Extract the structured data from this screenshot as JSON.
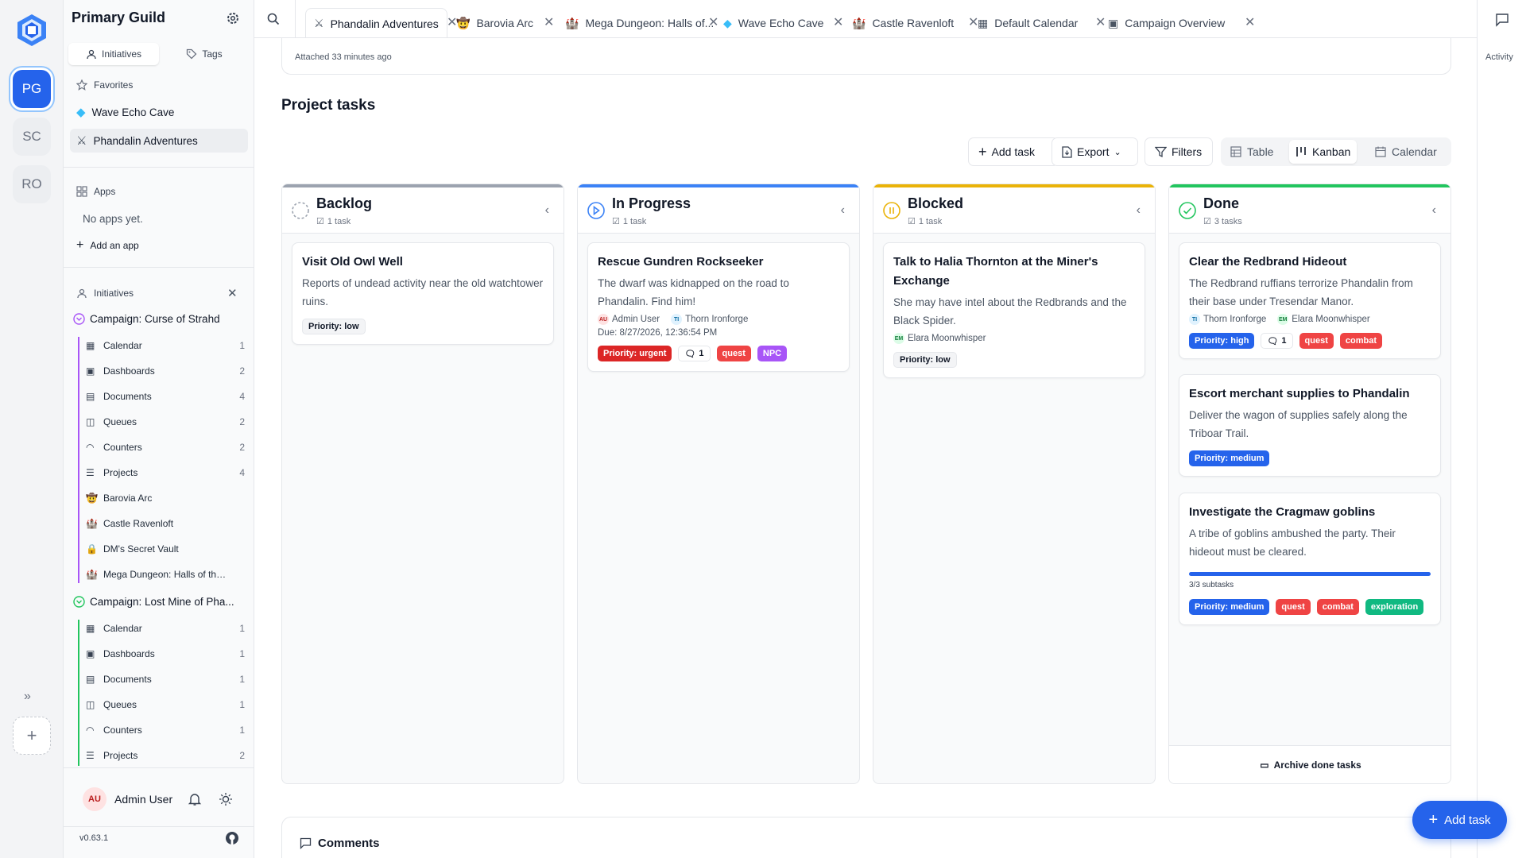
{
  "rail": {
    "workspaces": [
      "PG",
      "SC",
      "RO"
    ],
    "expand_glyph": "»",
    "add_glyph": "+"
  },
  "sidebar": {
    "guild_title": "Primary Guild",
    "tabs": [
      {
        "label": "Initiatives",
        "icon": "users-icon"
      },
      {
        "label": "Tags",
        "icon": "tag-icon"
      }
    ],
    "favorites_label": "Favorites",
    "favorites": [
      {
        "label": "Wave Echo Cave",
        "icon": "gem-icon"
      },
      {
        "label": "Phandalin Adventures",
        "icon": "swords-icon"
      }
    ],
    "apps_label": "Apps",
    "no_apps": "No apps yet.",
    "add_app": "Add an app",
    "initiatives_label": "Initiatives",
    "campaigns": [
      {
        "name": "Campaign: Curse of Strahd",
        "color": "#a855f7",
        "items": [
          {
            "label": "Calendar",
            "count": "1",
            "icon": "calendar-icon"
          },
          {
            "label": "Dashboards",
            "count": "2",
            "icon": "dashboard-icon"
          },
          {
            "label": "Documents",
            "count": "4",
            "icon": "document-icon"
          },
          {
            "label": "Queues",
            "count": "2",
            "icon": "queue-icon"
          },
          {
            "label": "Counters",
            "count": "2",
            "icon": "counter-icon"
          },
          {
            "label": "Projects",
            "count": "4",
            "icon": "project-icon"
          },
          {
            "label": "Barovia Arc",
            "count": "",
            "icon": "cowboy-icon"
          },
          {
            "label": "Castle Ravenloft",
            "count": "",
            "icon": "castle-icon"
          },
          {
            "label": "DM's Secret Vault",
            "count": "",
            "icon": "lock-icon"
          },
          {
            "label": "Mega Dungeon: Halls of the ...",
            "count": "",
            "icon": "castle-icon"
          }
        ]
      },
      {
        "name": "Campaign: Lost Mine of Pha...",
        "color": "#22c55e",
        "items": [
          {
            "label": "Calendar",
            "count": "1",
            "icon": "calendar-icon"
          },
          {
            "label": "Dashboards",
            "count": "1",
            "icon": "dashboard-icon"
          },
          {
            "label": "Documents",
            "count": "1",
            "icon": "document-icon"
          },
          {
            "label": "Queues",
            "count": "1",
            "icon": "queue-icon"
          },
          {
            "label": "Counters",
            "count": "1",
            "icon": "counter-icon"
          },
          {
            "label": "Projects",
            "count": "2",
            "icon": "project-icon"
          }
        ]
      }
    ],
    "user": {
      "initials": "AU",
      "name": "Admin User"
    },
    "version": "v0.63.1"
  },
  "tabs": [
    {
      "label": "Phandalin Adventures",
      "icon": "swords-icon"
    },
    {
      "label": "Barovia Arc",
      "icon": "cowboy-icon"
    },
    {
      "label": "Mega Dungeon: Halls of...",
      "icon": "castle-icon"
    },
    {
      "label": "Wave Echo Cave",
      "icon": "gem-icon"
    },
    {
      "label": "Castle Ravenloft",
      "icon": "castle-icon"
    },
    {
      "label": "Default Calendar",
      "icon": "calendar-icon"
    },
    {
      "label": "Campaign Overview",
      "icon": "dashboard-icon"
    }
  ],
  "activity_label": "Activity",
  "attached_text": "Attached 33 minutes ago",
  "section_title": "Project tasks",
  "toolbar": {
    "add_task": "Add task",
    "export": "Export",
    "filters": "Filters"
  },
  "views": [
    "Table",
    "Kanban",
    "Calendar"
  ],
  "columns": [
    {
      "title": "Backlog",
      "count": "1 task",
      "color": "#9ca3af",
      "cards": [
        {
          "title": "Visit Old Owl Well",
          "desc": "Reports of undead activity near the old watchtower ruins.",
          "priority": "Priority: low",
          "priority_style": "plow"
        }
      ]
    },
    {
      "title": "In Progress",
      "count": "1 task",
      "color": "#3b82f6",
      "cards": [
        {
          "title": "Rescue Gundren Rockseeker",
          "desc": "The dwarf was kidnapped on the road to Phandalin. Find him!",
          "people": [
            {
              "initials": "AU",
              "name": "Admin User"
            },
            {
              "initials": "TI",
              "name": "Thorn Ironforge"
            }
          ],
          "due": "Due: 8/27/2026, 12:36:54 PM",
          "priority": "Priority: urgent",
          "priority_style": "pred",
          "comments": "1",
          "tags": [
            {
              "label": "quest",
              "style": "tred"
            },
            {
              "label": "NPC",
              "style": "tpur"
            }
          ]
        }
      ]
    },
    {
      "title": "Blocked",
      "count": "1 task",
      "color": "#eab308",
      "cards": [
        {
          "title": "Talk to Halia Thornton at the Miner's Exchange",
          "desc": "She may have intel about the Redbrands and the Black Spider.",
          "people": [
            {
              "initials": "EM",
              "name": "Elara Moonwhisper"
            }
          ],
          "priority": "Priority: low",
          "priority_style": "plow"
        }
      ]
    },
    {
      "title": "Done",
      "count": "3 tasks",
      "color": "#22c55e",
      "cards": [
        {
          "title": "Clear the Redbrand Hideout",
          "desc": "The Redbrand ruffians terrorize Phandalin from their base under Tresendar Manor.",
          "people": [
            {
              "initials": "TI",
              "name": "Thorn Ironforge"
            },
            {
              "initials": "EM",
              "name": "Elara Moonwhisper"
            }
          ],
          "priority": "Priority: high",
          "priority_style": "pblue",
          "comments": "1",
          "tags": [
            {
              "label": "quest",
              "style": "tred"
            },
            {
              "label": "combat",
              "style": "tred"
            }
          ]
        },
        {
          "title": "Escort merchant supplies to Phandalin",
          "desc": "Deliver the wagon of supplies safely along the Triboar Trail.",
          "priority": "Priority: medium",
          "priority_style": "pblue"
        },
        {
          "title": "Investigate the Cragmaw goblins",
          "desc": "A tribe of goblins ambushed the party. Their hideout must be cleared.",
          "progress": 1.0,
          "subtasks": "3/3 subtasks",
          "priority": "Priority: medium",
          "priority_style": "pblue",
          "tags": [
            {
              "label": "quest",
              "style": "tred"
            },
            {
              "label": "combat",
              "style": "tred"
            },
            {
              "label": "exploration",
              "style": "tgrn"
            }
          ]
        }
      ],
      "archive": "Archive done tasks"
    }
  ],
  "comments_title": "Comments",
  "fab_label": "Add task"
}
